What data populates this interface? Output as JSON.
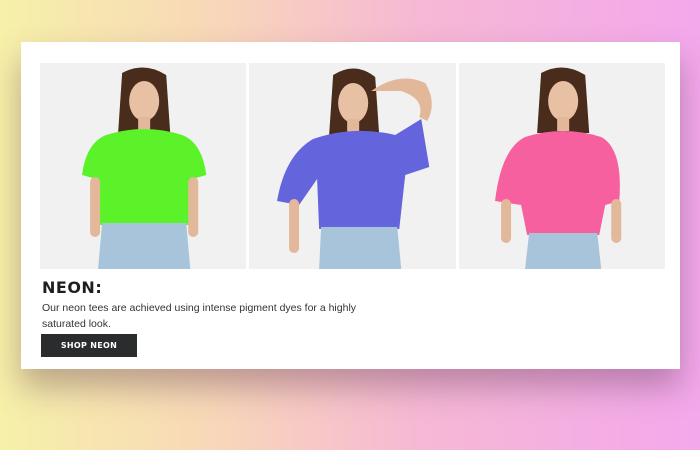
{
  "promo": {
    "title": "NEON:",
    "description": "Our neon tees are achieved using intense pigment dyes for a highly saturated look.",
    "button_label": "SHOP NEON"
  },
  "products": [
    {
      "shirt_color": "#5cf22a",
      "pose": "arms-down"
    },
    {
      "shirt_color": "#6464dc",
      "pose": "hand-on-head"
    },
    {
      "shirt_color": "#f7609e",
      "pose": "hands-in-pockets"
    }
  ],
  "colors": {
    "background_left": "#f6f0a8",
    "background_right": "#f3a8ec",
    "card": "#ffffff",
    "button": "#2b2c2e",
    "photo_backdrop": "#f1f1f1"
  }
}
